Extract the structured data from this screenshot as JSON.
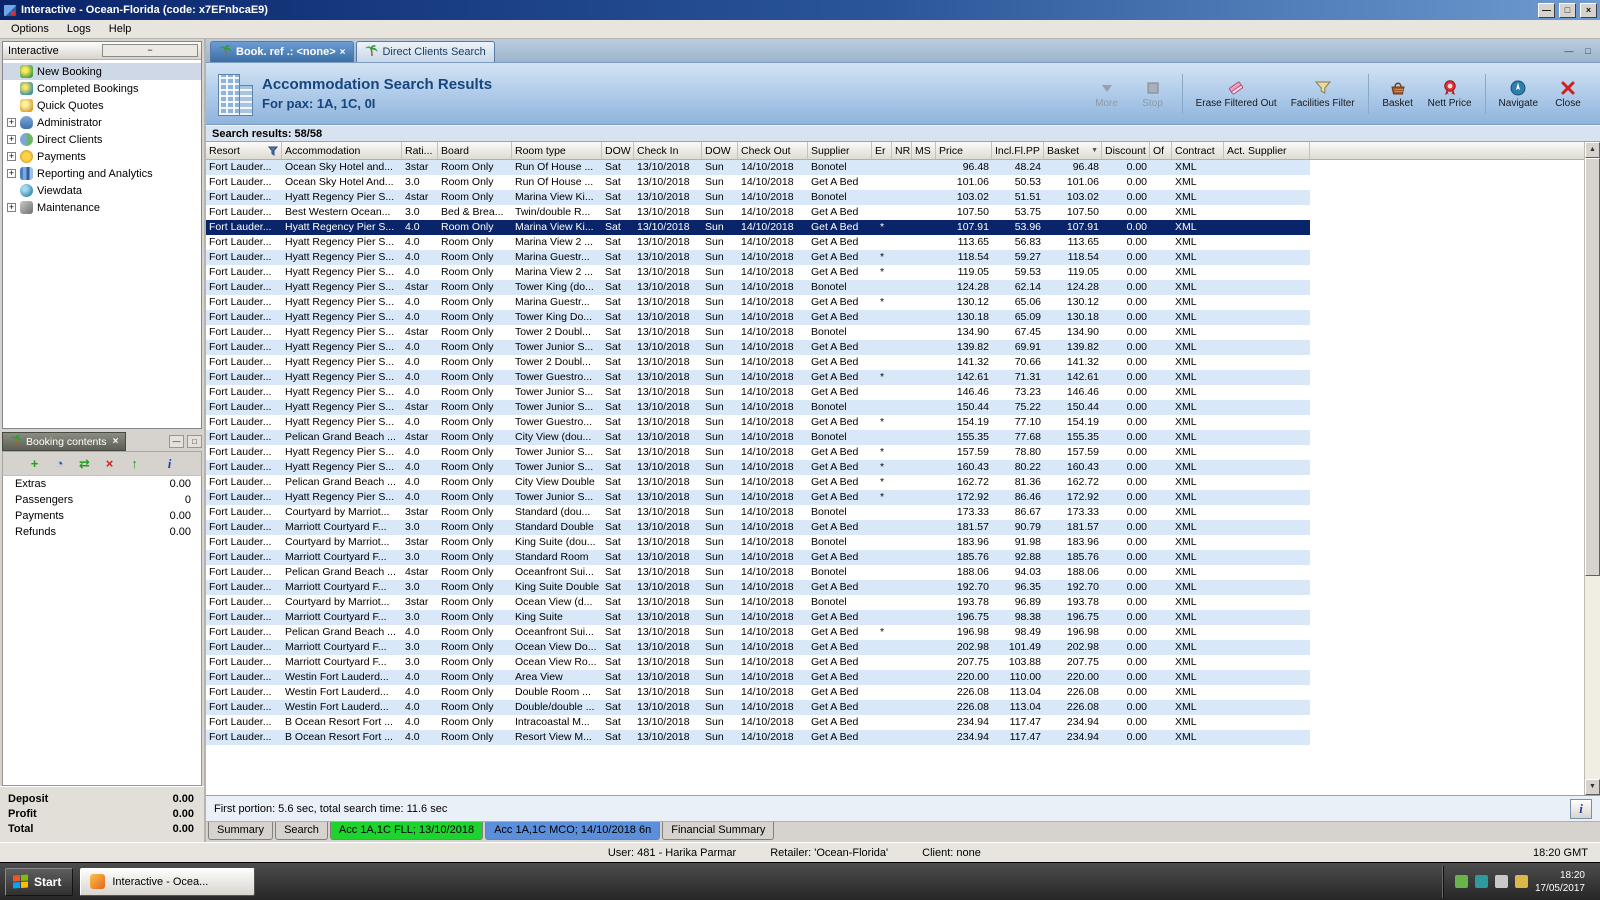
{
  "window": {
    "title": "Interactive - Ocean-Florida (code: x7EFnbcaE9)",
    "menu": [
      "Options",
      "Logs",
      "Help"
    ],
    "controls": {
      "minimize": "—",
      "maximize": "□",
      "close": "×"
    }
  },
  "colors": {
    "titlebar_blue": "#0a246a",
    "selection_navy": "#0a246a",
    "row_alternate_blue": "#d9e8f8",
    "bottom_tab_green": "#1fd32f",
    "bottom_tab_blue": "#5b8fdc",
    "header_text_blue": "#17457e"
  },
  "sidebar": {
    "title": "Interactive",
    "items": [
      {
        "label": "New Booking",
        "icon": "new-booking-icon",
        "selected": true,
        "expandable": false
      },
      {
        "label": "Completed Bookings",
        "icon": "completed-bookings-icon",
        "expandable": false
      },
      {
        "label": "Quick Quotes",
        "icon": "quick-quotes-icon",
        "expandable": false
      },
      {
        "label": "Administrator",
        "icon": "administrator-icon",
        "expandable": true
      },
      {
        "label": "Direct Clients",
        "icon": "direct-clients-icon",
        "expandable": true
      },
      {
        "label": "Payments",
        "icon": "payments-icon",
        "expandable": true
      },
      {
        "label": "Reporting and Analytics",
        "icon": "reporting-icon",
        "expandable": true
      },
      {
        "label": "Viewdata",
        "icon": "viewdata-icon",
        "expandable": false
      },
      {
        "label": "Maintenance",
        "icon": "maintenance-icon",
        "expandable": true
      }
    ]
  },
  "booking_contents": {
    "title": "Booking contents",
    "toolbar_icons": [
      "add-item-icon",
      "history-icon",
      "transfer-icon",
      "delete-icon",
      "move-up-icon",
      "info-icon"
    ],
    "rows": [
      {
        "label": "Extras",
        "value": "0.00"
      },
      {
        "label": "Passengers",
        "value": "0"
      },
      {
        "label": "Payments",
        "value": "0.00"
      },
      {
        "label": "Refunds",
        "value": "0.00"
      }
    ],
    "totals": [
      {
        "label": "Deposit",
        "value": "0.00"
      },
      {
        "label": "Profit",
        "value": "0.00"
      },
      {
        "label": "Total",
        "value": "0.00"
      }
    ]
  },
  "doc_tabs": [
    {
      "label": "Book. ref .: <none>",
      "active": true,
      "closable": true
    },
    {
      "label": "Direct Clients Search",
      "active": false,
      "closable": false
    }
  ],
  "results_header": {
    "title": "Accommodation Search Results",
    "subtitle": "For pax: 1A, 1C, 0I",
    "toolbar": [
      {
        "label": "More",
        "icon": "more-icon",
        "disabled": true
      },
      {
        "label": "Stop",
        "icon": "stop-icon",
        "disabled": true
      },
      {
        "label": "Erase Filtered Out",
        "icon": "eraser-icon",
        "disabled": false
      },
      {
        "label": "Facilities Filter",
        "icon": "filter-funnel-icon",
        "disabled": false
      },
      {
        "label": "Basket",
        "icon": "basket-icon",
        "disabled": false
      },
      {
        "label": "Nett Price",
        "icon": "nett-price-rosette-icon",
        "disabled": false
      },
      {
        "label": "Navigate",
        "icon": "navigate-compass-icon",
        "disabled": false
      },
      {
        "label": "Close",
        "icon": "close-x-icon",
        "disabled": false
      }
    ]
  },
  "search_results_bar": "Search results: 58/58",
  "grid": {
    "columns": [
      "Resort",
      "Accommodation",
      "Rati...",
      "Board",
      "Room type",
      "DOW",
      "Check In",
      "DOW",
      "Check Out",
      "Supplier",
      "Er",
      "NR",
      "MS",
      "Price",
      "Incl.Fl.PP",
      "Basket",
      "Discount",
      "Of",
      "Contract",
      "Act. Supplier"
    ],
    "filtered_column": "Resort",
    "sorted_column": "Basket",
    "selected_row": 4,
    "constants": {
      "resort": "Fort Lauder...",
      "dow_in": "Sat",
      "check_in": "13/10/2018",
      "dow_out": "Sun",
      "check_out": "14/10/2018",
      "discount": "0.00",
      "contract": "XML"
    },
    "row_fields": [
      "accommodation",
      "rating",
      "board",
      "room_type",
      "supplier",
      "er",
      "price",
      "incl_fl_pp"
    ],
    "rows": [
      [
        "Ocean Sky Hotel and...",
        "3star",
        "Room Only",
        "Run Of House ...",
        "Bonotel",
        "",
        "96.48",
        "48.24"
      ],
      [
        "Ocean Sky Hotel And...",
        "3.0",
        "Room Only",
        "Run Of House ...",
        "Get A Bed",
        "",
        "101.06",
        "50.53"
      ],
      [
        "Hyatt Regency Pier S...",
        "4star",
        "Room Only",
        "Marina View Ki...",
        "Bonotel",
        "",
        "103.02",
        "51.51"
      ],
      [
        "Best Western Ocean...",
        "3.0",
        "Bed & Brea...",
        "Twin/double R...",
        "Get A Bed",
        "",
        "107.50",
        "53.75"
      ],
      [
        "Hyatt Regency Pier S...",
        "4.0",
        "Room Only",
        "Marina View Ki...",
        "Get A Bed",
        "*",
        "107.91",
        "53.96"
      ],
      [
        "Hyatt Regency Pier S...",
        "4.0",
        "Room Only",
        "Marina View 2 ...",
        "Get A Bed",
        "",
        "113.65",
        "56.83"
      ],
      [
        "Hyatt Regency Pier S...",
        "4.0",
        "Room Only",
        "Marina Guestr...",
        "Get A Bed",
        "*",
        "118.54",
        "59.27"
      ],
      [
        "Hyatt Regency Pier S...",
        "4.0",
        "Room Only",
        "Marina View 2 ...",
        "Get A Bed",
        "*",
        "119.05",
        "59.53"
      ],
      [
        "Hyatt Regency Pier S...",
        "4star",
        "Room Only",
        "Tower King (do...",
        "Bonotel",
        "",
        "124.28",
        "62.14"
      ],
      [
        "Hyatt Regency Pier S...",
        "4.0",
        "Room Only",
        "Marina Guestr...",
        "Get A Bed",
        "*",
        "130.12",
        "65.06"
      ],
      [
        "Hyatt Regency Pier S...",
        "4.0",
        "Room Only",
        "Tower King Do...",
        "Get A Bed",
        "",
        "130.18",
        "65.09"
      ],
      [
        "Hyatt Regency Pier S...",
        "4star",
        "Room Only",
        "Tower 2 Doubl...",
        "Bonotel",
        "",
        "134.90",
        "67.45"
      ],
      [
        "Hyatt Regency Pier S...",
        "4.0",
        "Room Only",
        "Tower Junior S...",
        "Get A Bed",
        "",
        "139.82",
        "69.91"
      ],
      [
        "Hyatt Regency Pier S...",
        "4.0",
        "Room Only",
        "Tower 2 Doubl...",
        "Get A Bed",
        "",
        "141.32",
        "70.66"
      ],
      [
        "Hyatt Regency Pier S...",
        "4.0",
        "Room Only",
        "Tower Guestro...",
        "Get A Bed",
        "*",
        "142.61",
        "71.31"
      ],
      [
        "Hyatt Regency Pier S...",
        "4.0",
        "Room Only",
        "Tower Junior S...",
        "Get A Bed",
        "",
        "146.46",
        "73.23"
      ],
      [
        "Hyatt Regency Pier S...",
        "4star",
        "Room Only",
        "Tower Junior S...",
        "Bonotel",
        "",
        "150.44",
        "75.22"
      ],
      [
        "Hyatt Regency Pier S...",
        "4.0",
        "Room Only",
        "Tower Guestro...",
        "Get A Bed",
        "*",
        "154.19",
        "77.10"
      ],
      [
        "Pelican Grand Beach ...",
        "4star",
        "Room Only",
        "City View (dou...",
        "Bonotel",
        "",
        "155.35",
        "77.68"
      ],
      [
        "Hyatt Regency Pier S...",
        "4.0",
        "Room Only",
        "Tower Junior S...",
        "Get A Bed",
        "*",
        "157.59",
        "78.80"
      ],
      [
        "Hyatt Regency Pier S...",
        "4.0",
        "Room Only",
        "Tower Junior S...",
        "Get A Bed",
        "*",
        "160.43",
        "80.22"
      ],
      [
        "Pelican Grand Beach ...",
        "4.0",
        "Room Only",
        "City View Double",
        "Get A Bed",
        "*",
        "162.72",
        "81.36"
      ],
      [
        "Hyatt Regency Pier S...",
        "4.0",
        "Room Only",
        "Tower Junior S...",
        "Get A Bed",
        "*",
        "172.92",
        "86.46"
      ],
      [
        "Courtyard by Marriot...",
        "3star",
        "Room Only",
        "Standard (dou...",
        "Bonotel",
        "",
        "173.33",
        "86.67"
      ],
      [
        "Marriott Courtyard F...",
        "3.0",
        "Room Only",
        "Standard Double",
        "Get A Bed",
        "",
        "181.57",
        "90.79"
      ],
      [
        "Courtyard by Marriot...",
        "3star",
        "Room Only",
        "King Suite (dou...",
        "Bonotel",
        "",
        "183.96",
        "91.98"
      ],
      [
        "Marriott Courtyard F...",
        "3.0",
        "Room Only",
        "Standard Room",
        "Get A Bed",
        "",
        "185.76",
        "92.88"
      ],
      [
        "Pelican Grand Beach ...",
        "4star",
        "Room Only",
        "Oceanfront Sui...",
        "Bonotel",
        "",
        "188.06",
        "94.03"
      ],
      [
        "Marriott Courtyard F...",
        "3.0",
        "Room Only",
        "King Suite Double",
        "Get A Bed",
        "",
        "192.70",
        "96.35"
      ],
      [
        "Courtyard by Marriot...",
        "3star",
        "Room Only",
        "Ocean View (d...",
        "Bonotel",
        "",
        "193.78",
        "96.89"
      ],
      [
        "Marriott Courtyard F...",
        "3.0",
        "Room Only",
        "King Suite",
        "Get A Bed",
        "",
        "196.75",
        "98.38"
      ],
      [
        "Pelican Grand Beach ...",
        "4.0",
        "Room Only",
        "Oceanfront Sui...",
        "Get A Bed",
        "*",
        "196.98",
        "98.49"
      ],
      [
        "Marriott Courtyard F...",
        "3.0",
        "Room Only",
        "Ocean View Do...",
        "Get A Bed",
        "",
        "202.98",
        "101.49"
      ],
      [
        "Marriott Courtyard F...",
        "3.0",
        "Room Only",
        "Ocean View Ro...",
        "Get A Bed",
        "",
        "207.75",
        "103.88"
      ],
      [
        "Westin Fort Lauderd...",
        "4.0",
        "Room Only",
        "Area View",
        "Get A Bed",
        "",
        "220.00",
        "110.00"
      ],
      [
        "Westin Fort Lauderd...",
        "4.0",
        "Room Only",
        "Double Room ...",
        "Get A Bed",
        "",
        "226.08",
        "113.04"
      ],
      [
        "Westin Fort Lauderd...",
        "4.0",
        "Room Only",
        "Double/double ...",
        "Get A Bed",
        "",
        "226.08",
        "113.04"
      ],
      [
        "B Ocean Resort Fort ...",
        "4.0",
        "Room Only",
        "Intracoastal M...",
        "Get A Bed",
        "",
        "234.94",
        "117.47"
      ],
      [
        "B Ocean Resort Fort ...",
        "4.0",
        "Room Only",
        "Resort View M...",
        "Get A Bed",
        "",
        "234.94",
        "117.47"
      ]
    ]
  },
  "grid_footer": {
    "status": "First portion: 5.6 sec, total search time: 11.6 sec",
    "info_button": "i"
  },
  "bottom_tabs": [
    {
      "label": "Summary",
      "style": "plain"
    },
    {
      "label": "Search",
      "style": "plain"
    },
    {
      "label": "Acc 1A,1C FLL; 13/10/2018",
      "style": "green",
      "active": true
    },
    {
      "label": "Acc 1A,1C MCO; 14/10/2018 6n",
      "style": "blue"
    },
    {
      "label": "Financial Summary",
      "style": "plain"
    }
  ],
  "status_bar": {
    "user": "User: 481 - Harika Parmar",
    "retailer": "Retailer: 'Ocean-Florida'",
    "client": "Client: none",
    "time": "18:20 GMT"
  },
  "taskbar": {
    "start_label": "Start",
    "task_label": "Interactive - Ocea...",
    "time": "18:20",
    "date": "17/05/2017"
  }
}
